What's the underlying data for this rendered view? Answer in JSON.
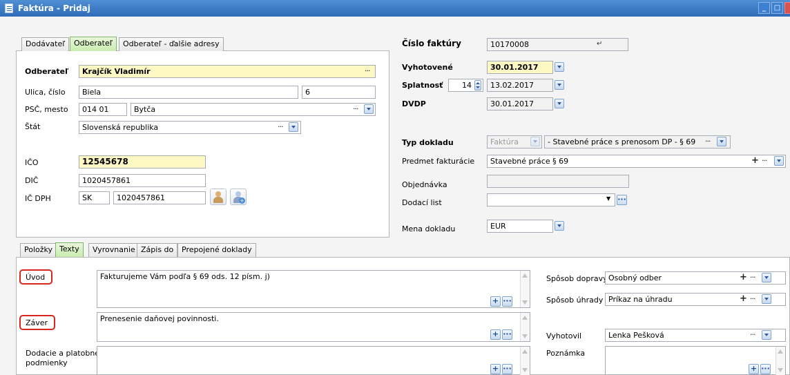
{
  "window": {
    "title": "Faktúra - Pridaj"
  },
  "partner_tabs": [
    "Dodávateľ",
    "Odberateľ",
    "Odberateľ - ďalšie adresy"
  ],
  "odberatel": {
    "name_label": "Odberateľ",
    "name": "Krajčík Vladimír",
    "street_label": "Ulica, číslo",
    "street": "Biela",
    "number": "6",
    "city_label": "PSČ, mesto",
    "zip": "014 01",
    "city": "Bytča",
    "country_label": "Štát",
    "country": "Slovenská republika",
    "ico_label": "IČO",
    "ico": "12545678",
    "dic_label": "DIČ",
    "dic": "1020457861",
    "icdph_label": "IČ DPH",
    "icdph_prefix": "SK",
    "icdph": "1020457861"
  },
  "header": {
    "cislo_label": "Číslo faktúry",
    "cislo": "10170008",
    "vyhotovene_label": "Vyhotovené",
    "vyhotovene": "30.01.2017",
    "splatnost_label": "Splatnosť",
    "splatnost_days": "14",
    "splatnost": "13.02.2017",
    "dvdp_label": "DVDP",
    "dvdp": "30.01.2017",
    "typ_label": "Typ dokladu",
    "typ": "Faktúra",
    "typ_detail": "- Stavebné práce s prenosom DP - § 69",
    "predmet_label": "Predmet fakturácie",
    "predmet": "Stavebné práce § 69",
    "objednavka_label": "Objednávka",
    "objednavka": "",
    "dodaci_label": "Dodací list",
    "dodaci": "",
    "mena_label": "Mena dokladu",
    "mena": "EUR"
  },
  "lower_tabs": [
    "Položky",
    "Texty",
    "Vyrovnanie",
    "Zápis do",
    "Prepojené doklady"
  ],
  "texty": {
    "uvod_label": "Úvod",
    "uvod": "Fakturujeme Vám podľa § 69 ods. 12 písm. j)",
    "zaver_label": "Záver",
    "zaver": "Prenesenie daňovej povinnosti.",
    "dodacie_label_1": "Dodacie a platobné",
    "dodacie_label_2": "podmienky",
    "dodacie": ""
  },
  "side": {
    "doprava_label": "Spôsob dopravy",
    "doprava": "Osobný odber",
    "uhrada_label": "Spôsob úhrady",
    "uhrada": "Príkaz na úhradu",
    "vyhotovil_label": "Vyhotovil",
    "vyhotovil": "Lenka Pešková",
    "poznamka_label": "Poznámka",
    "poznamka": ""
  },
  "symbols": {
    "ellipsis": "···",
    "plus": "+"
  },
  "colors": {
    "active_tab": "#c9ecb0",
    "highlight_field": "#fdf8c4",
    "annotation": "#d9261c",
    "titlebar": "#2f6cb8"
  }
}
